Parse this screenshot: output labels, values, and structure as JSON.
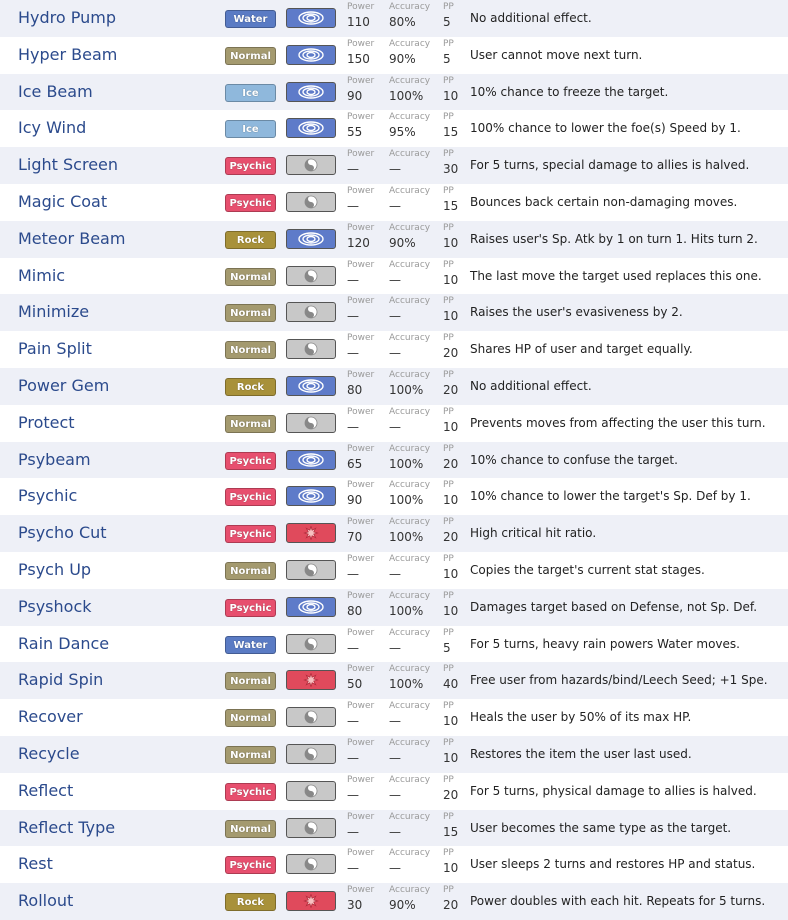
{
  "labels": {
    "power": "Power",
    "accuracy": "Accuracy",
    "pp": "PP"
  },
  "type_colors": {
    "Water": "#5a7bc4",
    "Normal": "#a49a6f",
    "Ice": "#8fb8dc",
    "Psychic": "#e74f6e",
    "Rock": "#a8913a"
  },
  "category_colors": {
    "special": "#5e7bc9",
    "status": "#c8c8c8",
    "physical": "#e04a5c"
  },
  "category_icons": {
    "special": "special-move-icon",
    "status": "status-move-icon",
    "physical": "physical-move-icon"
  },
  "moves": [
    {
      "name": "Hydro Pump",
      "type": "Water",
      "category": "special",
      "power": "110",
      "accuracy": "80%",
      "pp": "5",
      "effect": "No additional effect."
    },
    {
      "name": "Hyper Beam",
      "type": "Normal",
      "category": "special",
      "power": "150",
      "accuracy": "90%",
      "pp": "5",
      "effect": "User cannot move next turn."
    },
    {
      "name": "Ice Beam",
      "type": "Ice",
      "category": "special",
      "power": "90",
      "accuracy": "100%",
      "pp": "10",
      "effect": "10% chance to freeze the target."
    },
    {
      "name": "Icy Wind",
      "type": "Ice",
      "category": "special",
      "power": "55",
      "accuracy": "95%",
      "pp": "15",
      "effect": "100% chance to lower the foe(s) Speed by 1."
    },
    {
      "name": "Light Screen",
      "type": "Psychic",
      "category": "status",
      "power": "—",
      "accuracy": "—",
      "pp": "30",
      "effect": "For 5 turns, special damage to allies is halved."
    },
    {
      "name": "Magic Coat",
      "type": "Psychic",
      "category": "status",
      "power": "—",
      "accuracy": "—",
      "pp": "15",
      "effect": "Bounces back certain non-damaging moves."
    },
    {
      "name": "Meteor Beam",
      "type": "Rock",
      "category": "special",
      "power": "120",
      "accuracy": "90%",
      "pp": "10",
      "effect": "Raises user's Sp. Atk by 1 on turn 1. Hits turn 2."
    },
    {
      "name": "Mimic",
      "type": "Normal",
      "category": "status",
      "power": "—",
      "accuracy": "—",
      "pp": "10",
      "effect": "The last move the target used replaces this one."
    },
    {
      "name": "Minimize",
      "type": "Normal",
      "category": "status",
      "power": "—",
      "accuracy": "—",
      "pp": "10",
      "effect": "Raises the user's evasiveness by 2."
    },
    {
      "name": "Pain Split",
      "type": "Normal",
      "category": "status",
      "power": "—",
      "accuracy": "—",
      "pp": "20",
      "effect": "Shares HP of user and target equally."
    },
    {
      "name": "Power Gem",
      "type": "Rock",
      "category": "special",
      "power": "80",
      "accuracy": "100%",
      "pp": "20",
      "effect": "No additional effect."
    },
    {
      "name": "Protect",
      "type": "Normal",
      "category": "status",
      "power": "—",
      "accuracy": "—",
      "pp": "10",
      "effect": "Prevents moves from affecting the user this turn."
    },
    {
      "name": "Psybeam",
      "type": "Psychic",
      "category": "special",
      "power": "65",
      "accuracy": "100%",
      "pp": "20",
      "effect": "10% chance to confuse the target."
    },
    {
      "name": "Psychic",
      "type": "Psychic",
      "category": "special",
      "power": "90",
      "accuracy": "100%",
      "pp": "10",
      "effect": "10% chance to lower the target's Sp. Def by 1."
    },
    {
      "name": "Psycho Cut",
      "type": "Psychic",
      "category": "physical",
      "power": "70",
      "accuracy": "100%",
      "pp": "20",
      "effect": "High critical hit ratio."
    },
    {
      "name": "Psych Up",
      "type": "Normal",
      "category": "status",
      "power": "—",
      "accuracy": "—",
      "pp": "10",
      "effect": "Copies the target's current stat stages."
    },
    {
      "name": "Psyshock",
      "type": "Psychic",
      "category": "special",
      "power": "80",
      "accuracy": "100%",
      "pp": "10",
      "effect": "Damages target based on Defense, not Sp. Def."
    },
    {
      "name": "Rain Dance",
      "type": "Water",
      "category": "status",
      "power": "—",
      "accuracy": "—",
      "pp": "5",
      "effect": "For 5 turns, heavy rain powers Water moves."
    },
    {
      "name": "Rapid Spin",
      "type": "Normal",
      "category": "physical",
      "power": "50",
      "accuracy": "100%",
      "pp": "40",
      "effect": "Free user from hazards/bind/Leech Seed; +1 Spe."
    },
    {
      "name": "Recover",
      "type": "Normal",
      "category": "status",
      "power": "—",
      "accuracy": "—",
      "pp": "10",
      "effect": "Heals the user by 50% of its max HP."
    },
    {
      "name": "Recycle",
      "type": "Normal",
      "category": "status",
      "power": "—",
      "accuracy": "—",
      "pp": "10",
      "effect": "Restores the item the user last used."
    },
    {
      "name": "Reflect",
      "type": "Psychic",
      "category": "status",
      "power": "—",
      "accuracy": "—",
      "pp": "20",
      "effect": "For 5 turns, physical damage to allies is halved."
    },
    {
      "name": "Reflect Type",
      "type": "Normal",
      "category": "status",
      "power": "—",
      "accuracy": "—",
      "pp": "15",
      "effect": "User becomes the same type as the target."
    },
    {
      "name": "Rest",
      "type": "Psychic",
      "category": "status",
      "power": "—",
      "accuracy": "—",
      "pp": "10",
      "effect": "User sleeps 2 turns and restores HP and status."
    },
    {
      "name": "Rollout",
      "type": "Rock",
      "category": "physical",
      "power": "30",
      "accuracy": "90%",
      "pp": "20",
      "effect": "Power doubles with each hit. Repeats for 5 turns."
    }
  ]
}
